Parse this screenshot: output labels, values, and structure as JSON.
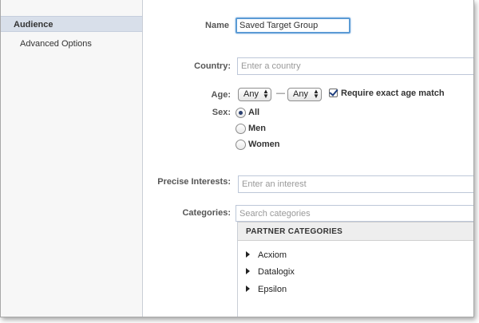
{
  "sidebar": {
    "items": [
      {
        "label": "Audience"
      },
      {
        "label": "Advanced Options"
      }
    ]
  },
  "form": {
    "name_label": "Name",
    "name_value": "Saved Target Group",
    "country_label": "Country:",
    "country_placeholder": "Enter a country",
    "age_label": "Age:",
    "age_min": "Any",
    "age_max": "Any",
    "age_dash": "—",
    "exact_age_label": "Require exact age match",
    "sex_label": "Sex:",
    "sex_options": [
      {
        "label": "All",
        "selected": true
      },
      {
        "label": "Men",
        "selected": false
      },
      {
        "label": "Women",
        "selected": false
      }
    ],
    "interests_label": "Precise Interests:",
    "interests_placeholder": "Enter an interest",
    "categories_label": "Categories:",
    "categories_placeholder": "Search categories"
  },
  "categories_panel": {
    "header": "PARTNER CATEGORIES",
    "items": [
      {
        "label": "Acxiom"
      },
      {
        "label": "Datalogix"
      },
      {
        "label": "Epsilon"
      }
    ]
  },
  "icons": {
    "select_arrows": "up-down-arrows-icon",
    "expand": "triangle-right-icon"
  }
}
